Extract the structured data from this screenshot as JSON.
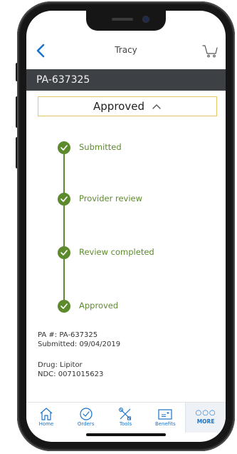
{
  "header": {
    "title": "Tracy"
  },
  "request": {
    "id_bar": "PA-637325",
    "status": "Approved"
  },
  "timeline": [
    {
      "label": "Submitted"
    },
    {
      "label": "Provider review"
    },
    {
      "label": "Review completed"
    },
    {
      "label": "Approved"
    }
  ],
  "details": {
    "pa_line": "PA #: PA-637325",
    "submitted_line": "Submitted: 09/04/2019",
    "drug_line": "Drug: Lipitor",
    "ndc_line": "NDC: 0071015623"
  },
  "tabs": [
    {
      "label": "Home",
      "icon": "home-icon"
    },
    {
      "label": "Orders",
      "icon": "check-circle-icon"
    },
    {
      "label": "Tools",
      "icon": "tools-icon"
    },
    {
      "label": "Benefits",
      "icon": "card-plus-icon"
    },
    {
      "label": "MORE",
      "icon": "more-dots-icon"
    }
  ],
  "colors": {
    "accent": "#1a73c8",
    "success": "#5e8a2e",
    "status_border": "#e6c66a",
    "id_bar_bg": "#3d4145"
  }
}
